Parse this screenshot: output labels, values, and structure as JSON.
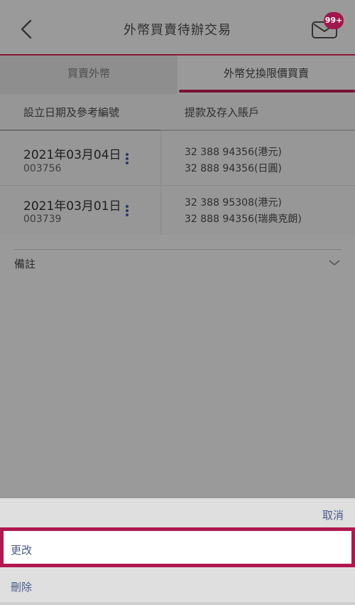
{
  "header": {
    "title": "外幣買賣待辦交易",
    "badge": "99+"
  },
  "tabs": [
    {
      "label": "買賣外幣"
    },
    {
      "label": "外幣兌換限價買賣"
    }
  ],
  "table": {
    "headers": [
      "設立日期及參考編號",
      "提款及存入賬戶"
    ],
    "rows": [
      {
        "date": "2021年03月04日",
        "ref": "003756",
        "from": "32 388 94356(港元)",
        "to": "32 888 94356(日圓)"
      },
      {
        "date": "2021年03月01日",
        "ref": "003739",
        "from": "32 388 95308(港元)",
        "to": "32 888 94356(瑞典克朗)"
      }
    ]
  },
  "remark": {
    "label": "備註"
  },
  "sheet": {
    "cancel": "取消",
    "edit": "更改",
    "delete": "刪除"
  },
  "colors": {
    "accent": "#b0184e",
    "badge": "#a0184c",
    "action_text": "#4a5a8a"
  },
  "icons": [
    "back-arrow-icon",
    "mail-icon",
    "kebab-menu-icon",
    "chevron-down-icon"
  ]
}
